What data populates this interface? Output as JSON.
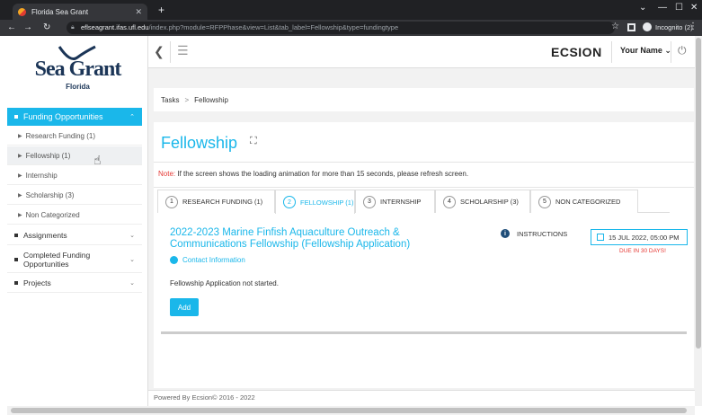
{
  "browser": {
    "tab_title": "Florida Sea Grant",
    "url_host": "eflseagrant.ifas.ufl.edu",
    "url_path": "/index.php?module=RFPPhase&view=List&tab_label=Fellowship&type=fundingtype",
    "profile": "Incognito (2)"
  },
  "logo": {
    "name": "Sea Grant",
    "sub": "Florida"
  },
  "sidebar": {
    "active": "Funding Opportunities",
    "subitems": [
      "Research Funding (1)",
      "Fellowship (1)",
      "Internship",
      "Scholarship (3)",
      "Non Categorized"
    ],
    "items": [
      "Assignments",
      "Completed Funding Opportunities",
      "Projects"
    ]
  },
  "header": {
    "brand": "ECSION",
    "user": "Your Name"
  },
  "breadcrumb": {
    "root": "Tasks",
    "current": "Fellowship"
  },
  "page": {
    "title": "Fellowship",
    "note_label": "Note:",
    "note_text": "If the screen shows the loading animation for more than 15 seconds, please refresh screen."
  },
  "tabs": [
    {
      "num": "1",
      "label": "RESEARCH FUNDING (1)"
    },
    {
      "num": "2",
      "label": "FELLOWSHIP (1)"
    },
    {
      "num": "3",
      "label": "INTERNSHIP"
    },
    {
      "num": "4",
      "label": "SCHOLARSHIP (3)"
    },
    {
      "num": "5",
      "label": "NON CATEGORIZED"
    }
  ],
  "application": {
    "title": "2022-2023 Marine Finfish Aquaculture Outreach & Communications Fellowship (Fellowship Application)",
    "contact": "Contact Information",
    "instructions": "INSTRUCTIONS",
    "due_date": "15 JUL 2022, 05:00 PM",
    "due_in": "DUE IN 30 DAYS!",
    "status": "Fellowship Application not started.",
    "add_label": "Add"
  },
  "footer": "Powered By Ecsion© 2016 - 2022",
  "colors": {
    "accent": "#1ab7ea",
    "note_red": "#e53935"
  }
}
